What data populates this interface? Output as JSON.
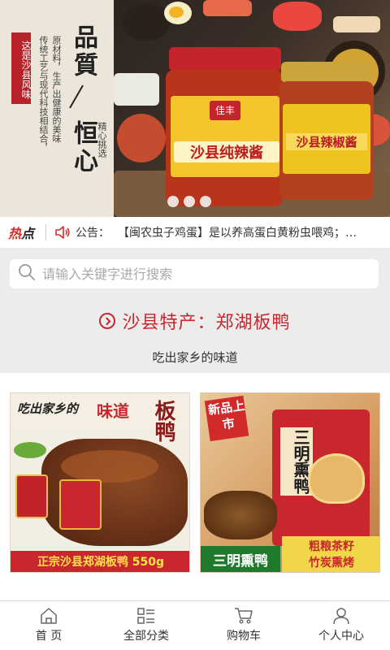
{
  "banner": {
    "tag_text": "这是沙县风味",
    "title_top": "品質",
    "title_bottom": "恒心",
    "desc_col1": "传统工艺与现代科技相结合，",
    "desc_col2": "原材料，生产出健康的美味",
    "desc_col3": "精心挑选",
    "jar1_label": "沙县纯辣酱",
    "jar1_brand": "佳丰",
    "jar2_label": "沙县辣椒酱",
    "slide_count": 3
  },
  "notice": {
    "hot_label_red": "热",
    "hot_label_black": "点",
    "label": "公告：",
    "text": "【闽农虫子鸡蛋】是以养高蛋白黄粉虫喂鸡；…"
  },
  "search": {
    "placeholder": "请输入关键字进行搜索"
  },
  "section": {
    "title": "沙县特产：郑湖板鸭",
    "subtitle": "吃出家乡的味道"
  },
  "products": [
    {
      "headline_a": "吃出家乡的",
      "headline_b": "味道",
      "side_text": "板鸭",
      "footer": "正宗沙县郑湖板鸭 550g"
    },
    {
      "badge": "新品上市",
      "pack_title": "三明熏鸭",
      "footer_left": "三明熏鸭",
      "footer_right_1": "粗粮茶籽",
      "footer_right_2": "竹炭熏烤"
    }
  ],
  "tabbar": {
    "items": [
      {
        "label": "首 页",
        "icon": "home-icon"
      },
      {
        "label": "全部分类",
        "icon": "category-icon"
      },
      {
        "label": "购物车",
        "icon": "cart-icon"
      },
      {
        "label": "个人中心",
        "icon": "user-icon"
      }
    ]
  },
  "colors": {
    "accent_red": "#c8272e",
    "hot_red": "#d52b2b"
  }
}
